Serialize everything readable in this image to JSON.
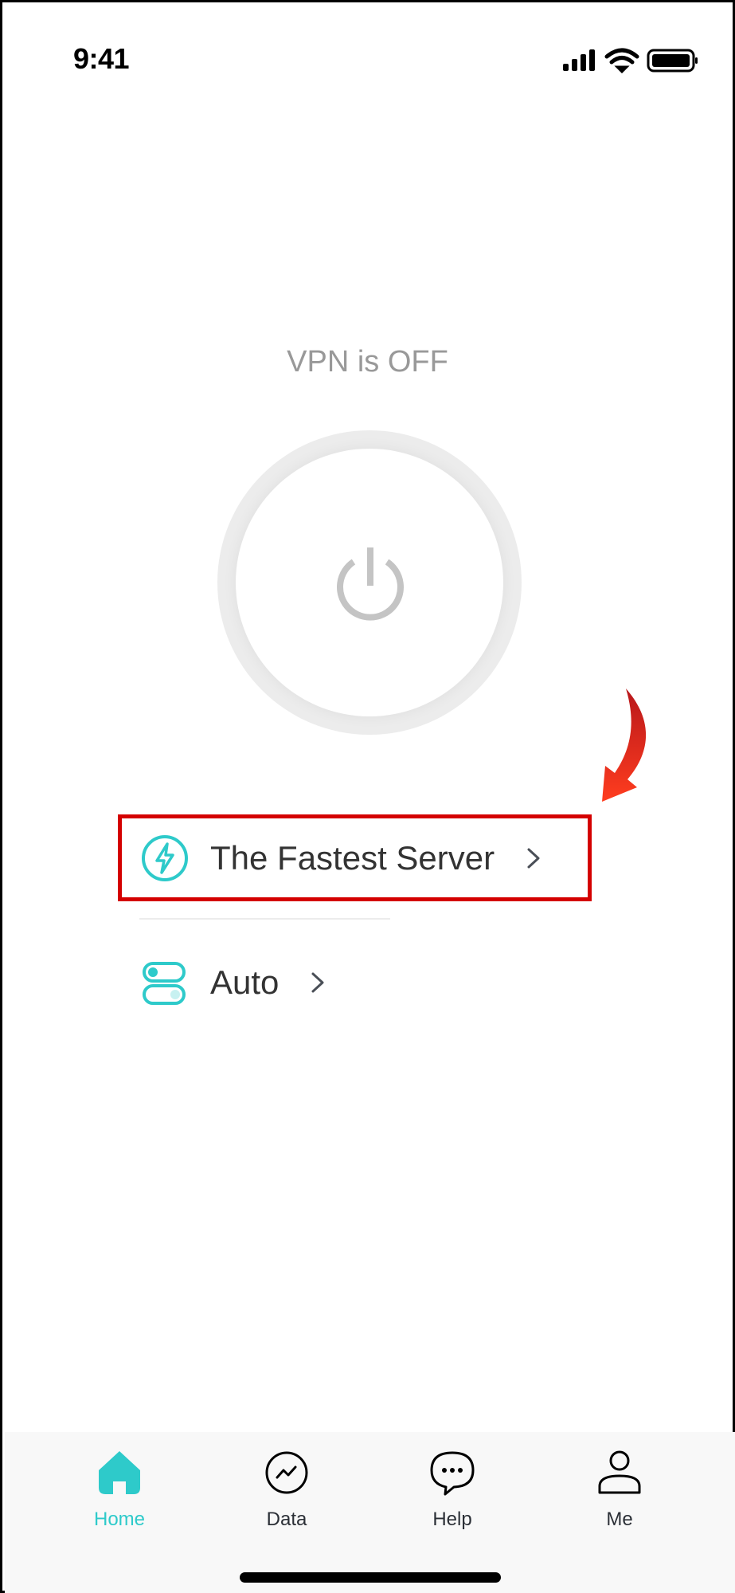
{
  "status_bar": {
    "time": "9:41",
    "icons": [
      "signal-icon",
      "wifi-icon",
      "battery-icon"
    ]
  },
  "vpn": {
    "status_text": "VPN is OFF",
    "power_button_icon": "power-icon",
    "state": "off"
  },
  "server_rows": [
    {
      "icon": "lightning-icon",
      "label": "The Fastest Server",
      "chevron": "chevron-right-icon",
      "highlighted": true
    },
    {
      "icon": "toggles-icon",
      "label": "Auto",
      "chevron": "chevron-right-icon",
      "highlighted": false
    }
  ],
  "annotation": {
    "arrow": "red-curved-arrow",
    "highlight_color": "#d40000"
  },
  "tabbar": {
    "active": "Home",
    "tabs": [
      {
        "label": "Home",
        "icon": "home-icon"
      },
      {
        "label": "Data",
        "icon": "chart-circle-icon"
      },
      {
        "label": "Help",
        "icon": "chat-bubble-icon"
      },
      {
        "label": "Me",
        "icon": "person-icon"
      }
    ]
  },
  "colors": {
    "accent": "#2ecaca",
    "text_primary": "#333333",
    "text_muted": "#999999",
    "power_icon": "#c4c4c4",
    "tabbar_bg": "#f8f8f8"
  }
}
